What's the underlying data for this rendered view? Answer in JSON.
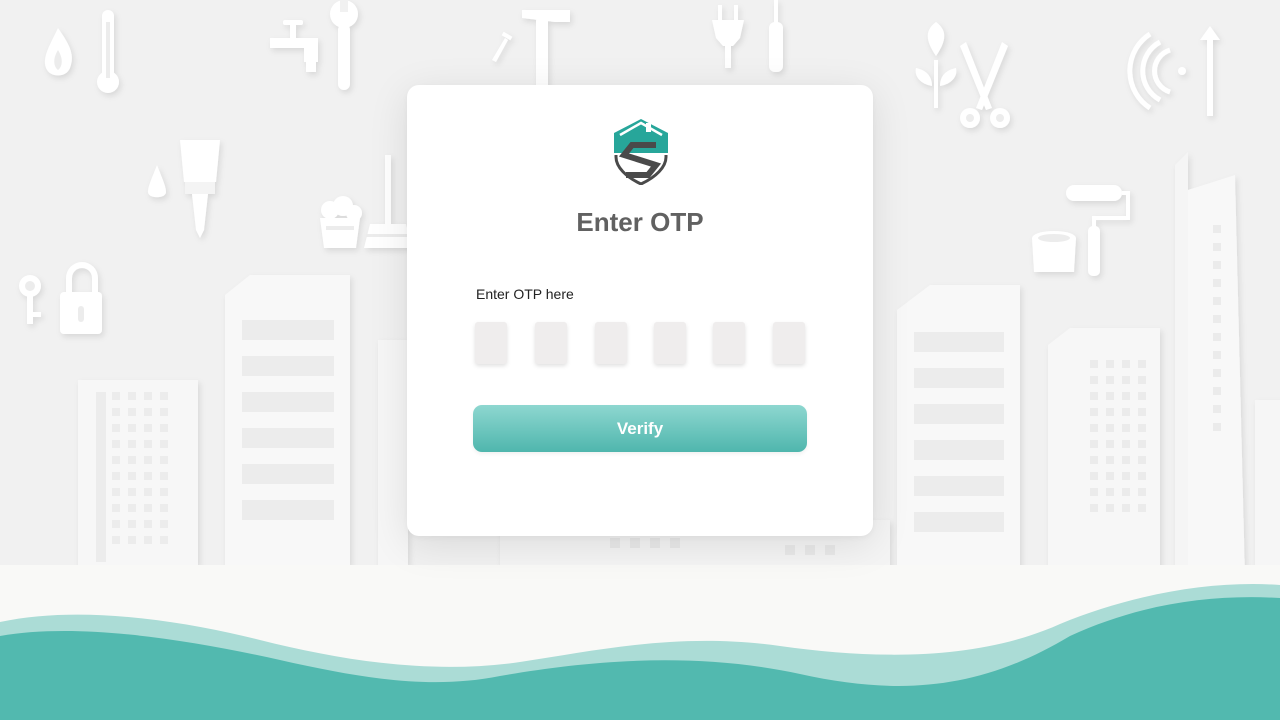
{
  "otp_card": {
    "title": "Enter OTP",
    "otp_label": "Enter OTP here",
    "otp_digits": [
      "",
      "",
      "",
      "",
      "",
      ""
    ],
    "verify_label": "Verify"
  },
  "colors": {
    "accent": "#4fb6ad",
    "accent_light": "#8ed7d0",
    "logo_teal": "#27a69a",
    "logo_dark": "#4a4a4a",
    "background": "#f1f1f1",
    "input_fill": "#efeded"
  },
  "icons": [
    "fire-icon",
    "thermometer-icon",
    "faucet-icon",
    "wrench-icon",
    "hammer-icon",
    "nail-icon",
    "plug-icon",
    "screwdriver-icon",
    "plant-icon",
    "scissors-icon",
    "wifi-icon",
    "antenna-icon",
    "water-drop-icon",
    "paintbrush-icon",
    "bucket-icon",
    "broom-icon",
    "key-icon",
    "padlock-icon",
    "paint-can-icon",
    "paint-roller-icon"
  ]
}
